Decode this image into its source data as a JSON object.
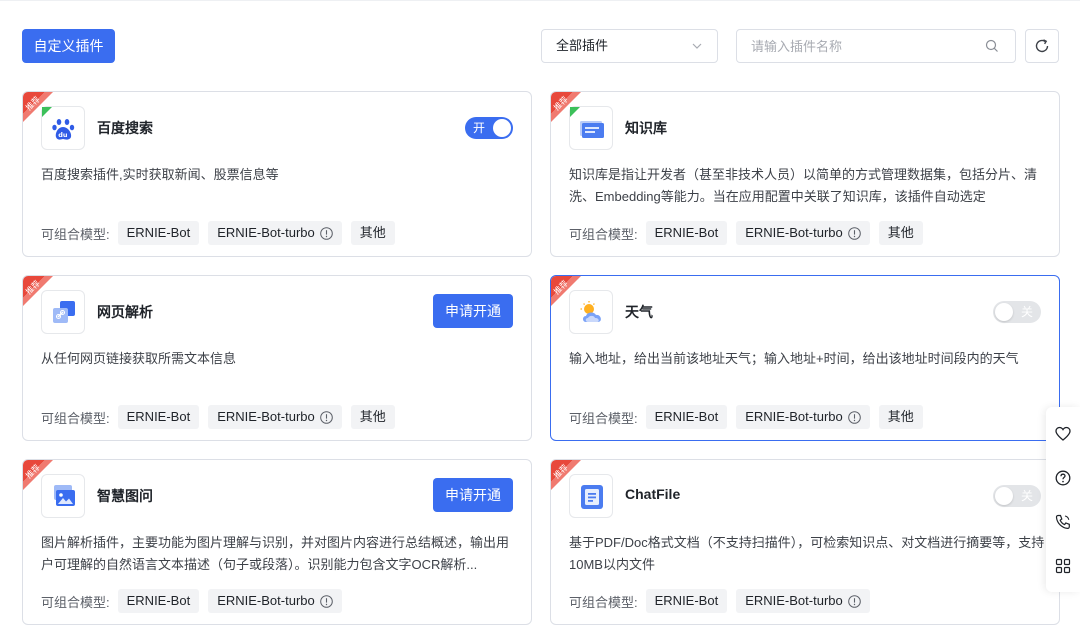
{
  "toolbar": {
    "custom_button": "自定义插件",
    "filter_value": "全部插件",
    "search_placeholder": "请输入插件名称"
  },
  "ribbon_text": "推荐",
  "model_label": "可组合模型:",
  "colors": {
    "primary": "#3a6df0",
    "ribbon": "#e8483b",
    "check": "#3cc05a"
  },
  "cards": [
    {
      "name": "百度搜索",
      "icon": "baidu-paw-icon",
      "desc": "百度搜索插件,实时获取新闻、股票信息等",
      "action": "toggle",
      "toggle_state": "on",
      "toggle_label": "开",
      "enabled_check": true,
      "models": [
        "ERNIE-Bot",
        "ERNIE-Bot-turbo",
        "其他"
      ]
    },
    {
      "name": "知识库",
      "icon": "knowledge-base-icon",
      "desc": "知识库是指让开发者（甚至非技术人员）以简单的方式管理数据集，包括分片、清洗、Embedding等能力。当在应用配置中关联了知识库，该插件自动选定",
      "action": "none",
      "enabled_check": true,
      "models": [
        "ERNIE-Bot",
        "ERNIE-Bot-turbo",
        "其他"
      ]
    },
    {
      "name": "网页解析",
      "icon": "web-link-icon",
      "desc": "从任何网页链接获取所需文本信息",
      "action": "apply",
      "apply_label": "申请开通",
      "enabled_check": false,
      "models": [
        "ERNIE-Bot",
        "ERNIE-Bot-turbo",
        "其他"
      ]
    },
    {
      "name": "天气",
      "icon": "weather-icon",
      "desc": "输入地址，给出当前该地址天气；输入地址+时间，给出该地址时间段内的天气",
      "action": "toggle",
      "toggle_state": "off",
      "toggle_label": "关",
      "enabled_check": false,
      "models": [
        "ERNIE-Bot",
        "ERNIE-Bot-turbo",
        "其他"
      ]
    },
    {
      "name": "智慧图问",
      "icon": "image-qa-icon",
      "desc": "图片解析插件，主要功能为图片理解与识别，并对图片内容进行总结概述，输出用户可理解的自然语言文本描述（句子或段落）。识别能力包含文字OCR解析...",
      "action": "apply",
      "apply_label": "申请开通",
      "enabled_check": false,
      "models": [
        "ERNIE-Bot",
        "ERNIE-Bot-turbo"
      ]
    },
    {
      "name": "ChatFile",
      "icon": "document-icon",
      "desc": "基于PDF/Doc格式文档（不支持扫描件），可检索知识点、对文档进行摘要等，支持10MB以内文件",
      "action": "toggle",
      "toggle_state": "off",
      "toggle_label": "关",
      "enabled_check": false,
      "models": [
        "ERNIE-Bot",
        "ERNIE-Bot-turbo"
      ]
    }
  ],
  "sidebar_icons": [
    "heart-icon",
    "help-icon",
    "phone-icon",
    "apps-grid-icon"
  ]
}
